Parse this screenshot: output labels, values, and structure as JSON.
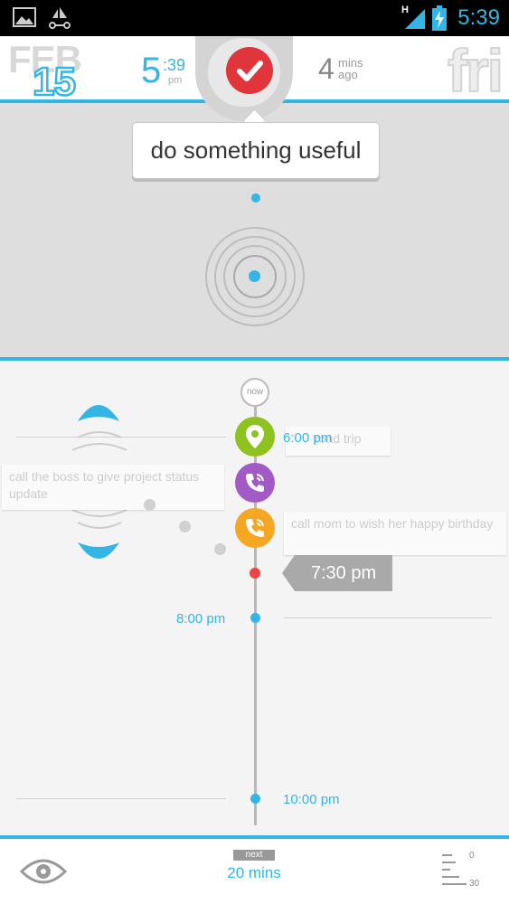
{
  "status_bar": {
    "time": "5:39",
    "network_type": "H",
    "icons": [
      "picture-icon",
      "sailboat-icon",
      "signal-icon",
      "battery-charging-icon"
    ]
  },
  "header": {
    "month": "FEB",
    "day": "15",
    "time_hour": "5",
    "time_minutes": ":39",
    "time_ampm": "pm",
    "ago_value": "4",
    "ago_unit": "mins ago",
    "weekday": "fri"
  },
  "current_task": {
    "text": "do something useful",
    "icon": "check-icon"
  },
  "timeline": {
    "now_label": "now",
    "current_time": "7:30 pm",
    "time_markers": [
      "6:00 pm",
      "8:00 pm",
      "10:00 pm"
    ],
    "tasks": [
      {
        "text": "road trip",
        "icon": "location-pin-icon",
        "color": "#8dc21f"
      },
      {
        "text": "call the boss to give project status update",
        "icon": "phone-icon",
        "color": "#a25bc5"
      },
      {
        "text": "call mom to wish her happy birthday",
        "icon": "phone-icon",
        "color": "#f5a623"
      }
    ]
  },
  "bottom_bar": {
    "next_label": "next",
    "next_value": "20 mins",
    "zoom_min": "0",
    "zoom_max": "30"
  },
  "colors": {
    "accent": "#33b5e5",
    "alert_red": "#e0353b",
    "now_dot": "#ee4444"
  }
}
